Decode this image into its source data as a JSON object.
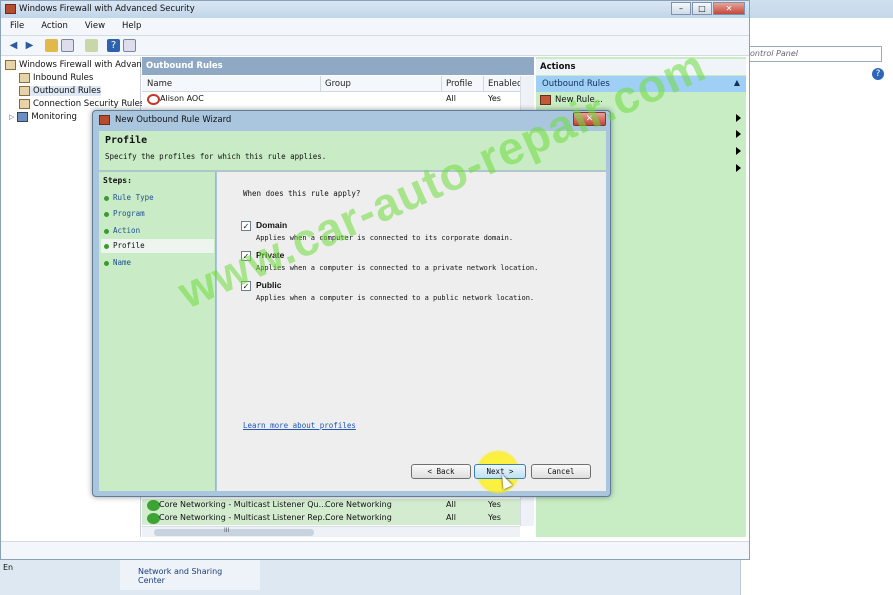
{
  "background": {
    "search_placeholder": "ontrol Panel",
    "network_link": "Network and Sharing Center",
    "language": "En"
  },
  "app": {
    "title": "Windows Firewall with Advanced Security",
    "menu": [
      "File",
      "Action",
      "View",
      "Help"
    ]
  },
  "tree": {
    "root": "Windows Firewall with Advance",
    "items": [
      "Inbound Rules",
      "Outbound Rules",
      "Connection Security Rules",
      "Monitoring"
    ]
  },
  "list": {
    "title": "Outbound Rules",
    "columns": [
      "Name",
      "Group",
      "Profile",
      "Enabled"
    ],
    "top_row": {
      "name": "Alison AOC",
      "group": "",
      "profile": "All",
      "enabled": "Yes",
      "status": "blocked"
    },
    "bottom_rows": [
      {
        "name": "Core Networking - Multicast Listener Qu...",
        "group": "Core Networking",
        "profile": "All",
        "enabled": "Yes"
      },
      {
        "name": "Core Networking - Multicast Listener Rep...",
        "group": "Core Networking",
        "profile": "All",
        "enabled": "Yes"
      }
    ],
    "hscroll_label": "III"
  },
  "actions": {
    "title": "Actions",
    "section": "Outbound Rules",
    "new_rule": "New Rule..."
  },
  "wizard": {
    "title": "New Outbound Rule Wizard",
    "heading": "Profile",
    "subheading": "Specify the profiles for which this rule applies.",
    "steps_label": "Steps:",
    "steps": [
      "Rule Type",
      "Program",
      "Action",
      "Profile",
      "Name"
    ],
    "current_step": "Profile",
    "question": "When does this rule apply?",
    "options": [
      {
        "label": "Domain",
        "desc": "Applies when a computer is connected to its corporate domain.",
        "checked": true
      },
      {
        "label": "Private",
        "desc": "Applies when a computer is connected to a private network location.",
        "checked": true
      },
      {
        "label": "Public",
        "desc": "Applies when a computer is connected to a public network location.",
        "checked": true
      }
    ],
    "learn_more": "Learn more about profiles",
    "back": "< Back",
    "next": "Next >",
    "cancel": "Cancel"
  },
  "watermark": "www.car-auto-repair.com"
}
